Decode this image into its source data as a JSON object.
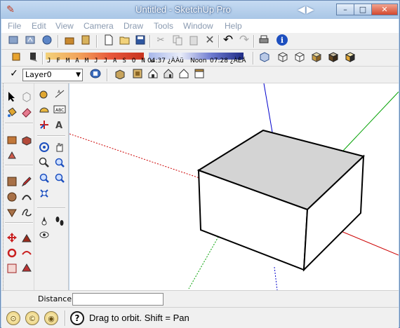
{
  "window": {
    "title": "Untitled - SketchUp Pro",
    "controls": {
      "minimize": "–",
      "maximize": "□",
      "close": "✕"
    }
  },
  "menu": [
    "File",
    "Edit",
    "View",
    "Camera",
    "Draw",
    "Tools",
    "Window",
    "Help"
  ],
  "shadow_settings": {
    "months": "J F M A M J J A S O N D",
    "time_left": "04:37 ¿ÀÀü",
    "time_mid": "Noon",
    "time_right": "07:28 ¿ÀÈÄ",
    "date_strip_colors": [
      "#f3d27a",
      "#f2a35a",
      "#e7563a",
      "#c7331e"
    ],
    "time_strip_colors": [
      "#a7b7ea",
      "#e9edf9",
      "#6c79cf",
      "#1f2b86"
    ]
  },
  "layers": {
    "current_layer": "Layer0",
    "check": "✓"
  },
  "measurements": {
    "label": "Distance",
    "value": ""
  },
  "status": {
    "text": "Drag to orbit.  Shift = Pan",
    "help": "?"
  },
  "icons": {
    "app": "sketchup-logo-icon",
    "geo": "geolocation-icon",
    "credits": "credits-icon",
    "account": "account-icon"
  },
  "colors": {
    "title_bg": "#b9d3ee",
    "face_top": "#d4d4d4",
    "face_side": "#ffffff",
    "axis_red": "#cc0000",
    "axis_green": "#00a000",
    "axis_blue": "#0000cc"
  }
}
